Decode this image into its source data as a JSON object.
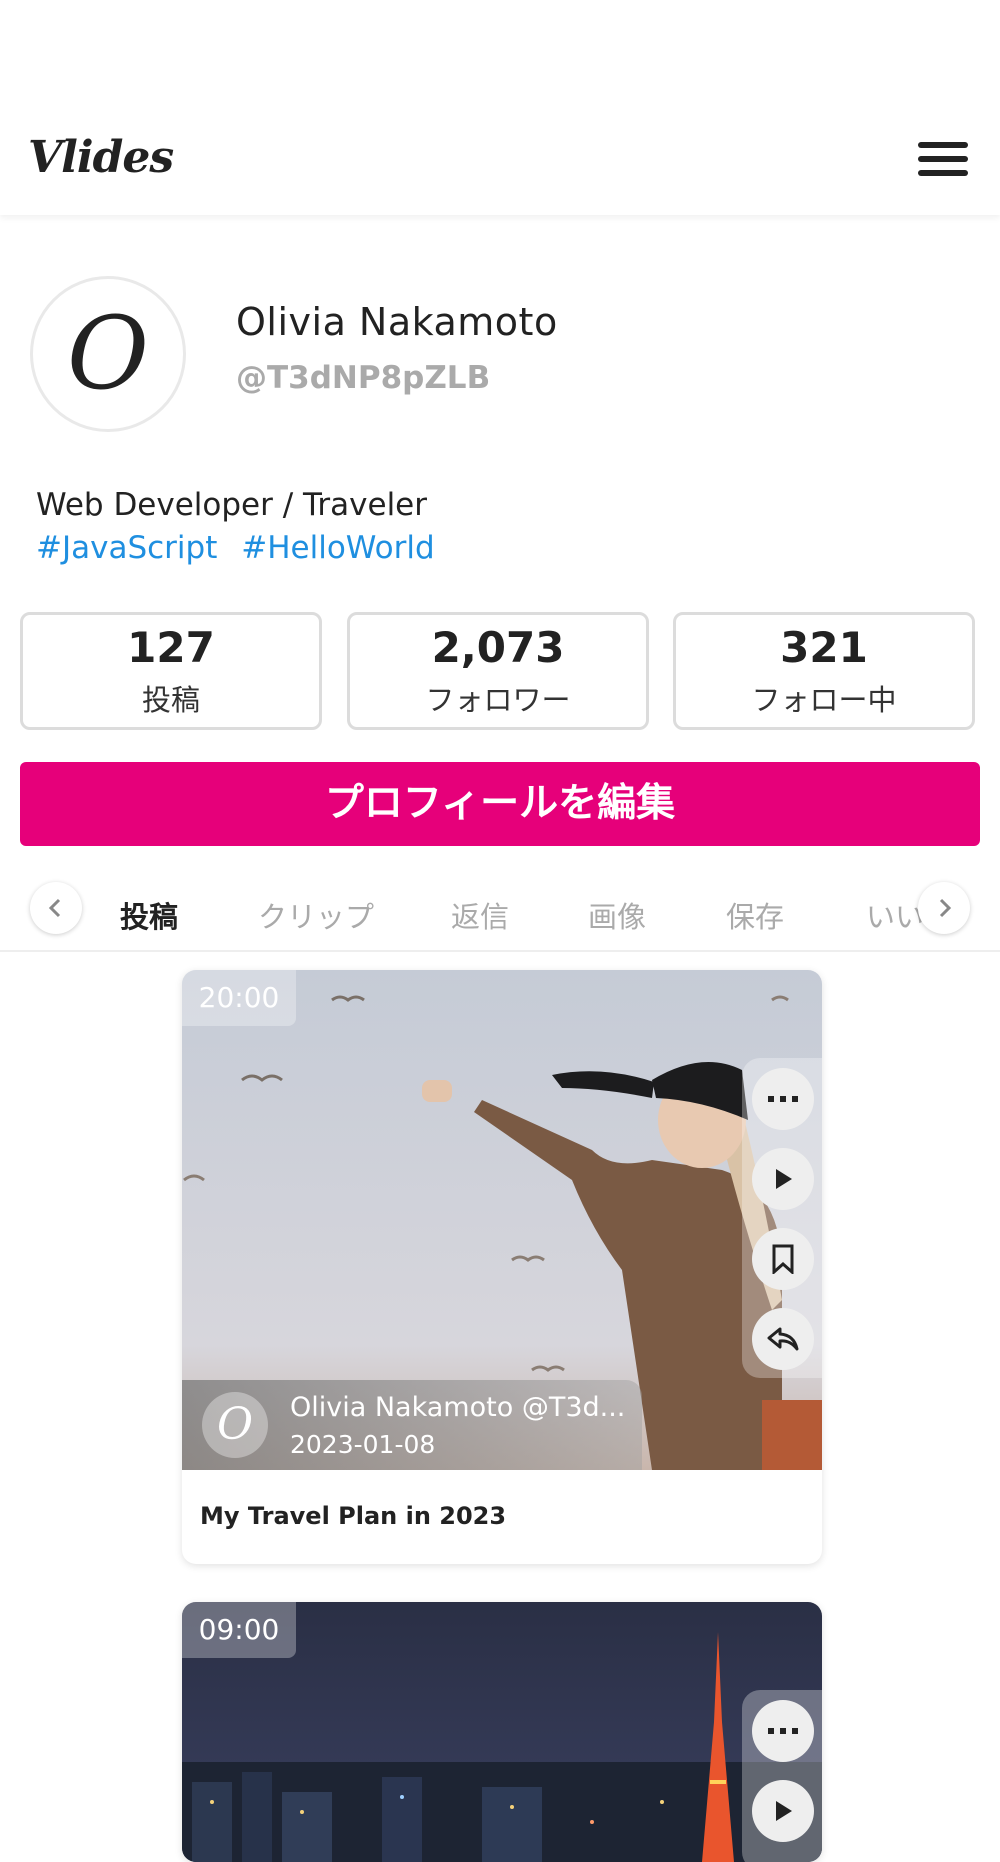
{
  "header": {
    "logo": "Vlides",
    "menu_icon": "hamburger-menu-icon"
  },
  "profile": {
    "avatar_letter": "O",
    "name": "Olivia  Nakamoto",
    "handle": "@T3dNP8pZLB",
    "bio": "Web Developer  /  Traveler",
    "tags": [
      "#JavaScript",
      "#HelloWorld"
    ]
  },
  "stats": [
    {
      "value": "127",
      "label": "投稿"
    },
    {
      "value": "2,073",
      "label": "フォロワー"
    },
    {
      "value": "321",
      "label": "フォロー中"
    }
  ],
  "edit_button": "プロフィールを編集",
  "tabs": {
    "items": [
      "投稿",
      "クリップ",
      "返信",
      "画像",
      "保存",
      "いいね"
    ],
    "active": "投稿",
    "prev_icon": "chevron-left-icon",
    "next_icon": "chevron-right-icon"
  },
  "posts": [
    {
      "time": "20:00",
      "author": "Olivia Nakamoto @T3d...",
      "author_initial": "O",
      "date": "2023-01-08",
      "title": "My Travel Plan in 2023",
      "actions": [
        "more-icon",
        "play-icon",
        "bookmark-icon",
        "reply-icon"
      ]
    },
    {
      "time": "09:00",
      "actions": [
        "more-icon",
        "play-icon"
      ]
    }
  ],
  "colors": {
    "accent": "#e6007a",
    "link": "#1f8fe0",
    "muted": "#aaaaaa"
  }
}
